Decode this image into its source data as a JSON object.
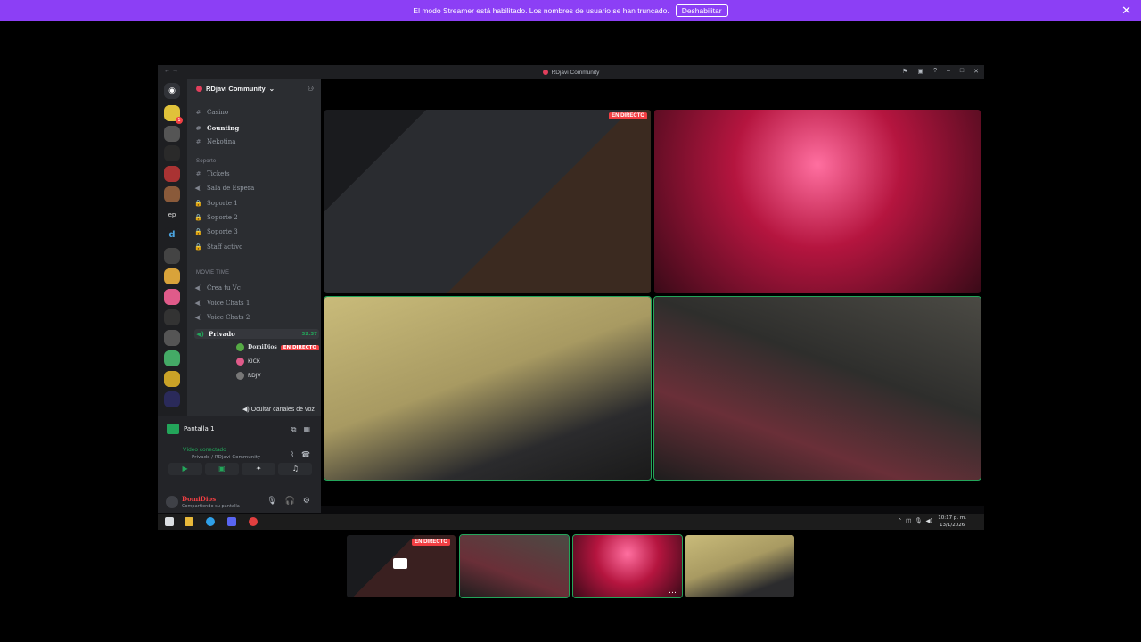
{
  "banner": {
    "message": "El modo Streamer está habilitado. Los nombres de usuario se han truncado.",
    "button": "Deshabilitar"
  },
  "window": {
    "title": "RDjavi Community"
  },
  "server": {
    "name": "RDjavi Community"
  },
  "channels": {
    "text_top": [
      {
        "label": "Casino",
        "icon": "hash-icon"
      },
      {
        "label": "Counting",
        "icon": "hash-icon",
        "active": true
      },
      {
        "label": "Nekotina",
        "icon": "hash-icon"
      }
    ],
    "cat_support": "Soporte",
    "support": [
      {
        "label": "Tickets",
        "icon": "hash-icon"
      },
      {
        "label": "Sala de Espera",
        "icon": "speaker-icon"
      },
      {
        "label": "Soporte 1",
        "icon": "lock-icon"
      },
      {
        "label": "Soporte 2",
        "icon": "lock-icon"
      },
      {
        "label": "Soporte 3",
        "icon": "lock-icon"
      },
      {
        "label": "Staff activo",
        "icon": "lock-icon"
      }
    ],
    "cat_movie": "MOVIE TIME",
    "movie": [
      {
        "label": "Crea tu Vc",
        "icon": "speaker-icon"
      },
      {
        "label": "Voice Chats 1",
        "icon": "speaker-icon"
      },
      {
        "label": "Voice Chats 2",
        "icon": "speaker-icon"
      }
    ],
    "private": {
      "label": "Privado",
      "time": "32:37"
    },
    "members": [
      {
        "name": "DomiDios",
        "live": "EN DIRECTO"
      },
      {
        "name": "KICK"
      },
      {
        "name": "RDJV"
      }
    ],
    "hide_vc": "Ocultar canales de voz"
  },
  "voice_panel": {
    "screen_label": "Pantalla 1",
    "video_status": "Vídeo conectado",
    "channel_path": "Privado / RDjavi Community"
  },
  "user": {
    "name": "DomiDios",
    "status": "Compartiendo su pantalla"
  },
  "stage": {
    "live_label": "EN DIRECTO"
  },
  "taskbar": {
    "time": "10:17 p. m.",
    "date": "13/1/2026"
  },
  "strip": {
    "live_label": "EN DIRECTO"
  },
  "colors": {
    "banner": "#8c3ff5",
    "live": "#f23f43",
    "speaking": "#23a55a"
  }
}
